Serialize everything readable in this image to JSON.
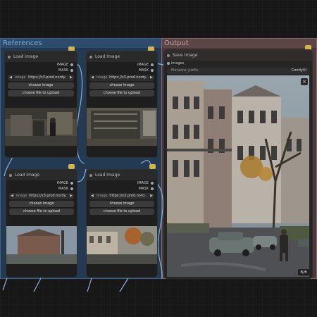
{
  "groups": {
    "references": {
      "title": "References"
    },
    "output": {
      "title": "Output"
    }
  },
  "load_nodes": [
    {
      "title": "Load Image",
      "outputs": [
        "IMAGE",
        "MASK"
      ],
      "image_label": "image",
      "image_value": "https://s3.prod.nordy.",
      "upload_choose": "choose image",
      "upload_file": "choose file to upload"
    },
    {
      "title": "Load Image",
      "outputs": [
        "IMAGE",
        "MASK"
      ],
      "image_label": "image",
      "image_value": "https://s3.prod.nordy.",
      "upload_choose": "choose image",
      "upload_file": "choose file to upload"
    },
    {
      "title": "Load Image",
      "outputs": [
        "IMAGE",
        "MASK"
      ],
      "image_label": "image",
      "image_value": "https://s3.prod.nordy.",
      "upload_choose": "choose image",
      "upload_file": "choose file to upload"
    },
    {
      "title": "Load Image",
      "outputs": [
        "IMAGE",
        "MASK"
      ],
      "image_label": "image",
      "image_value": "https://s3.prod.nord..",
      "upload_choose": "choose image",
      "upload_file": "choose file to upload"
    }
  ],
  "save_node": {
    "title": "Save Image",
    "input": "images",
    "prefix_label": "filename_prefix",
    "prefix_value": "ComfyUI",
    "counter": "6/6",
    "close_glyph": "×"
  },
  "colors": {
    "references_group": "#233a52",
    "output_group": "#4a3a3b",
    "link": "#87b2d8",
    "badge": "#d6b24a"
  },
  "icons": [
    "node-status-dot",
    "collapse-dot",
    "link-wire",
    "group-badge"
  ]
}
